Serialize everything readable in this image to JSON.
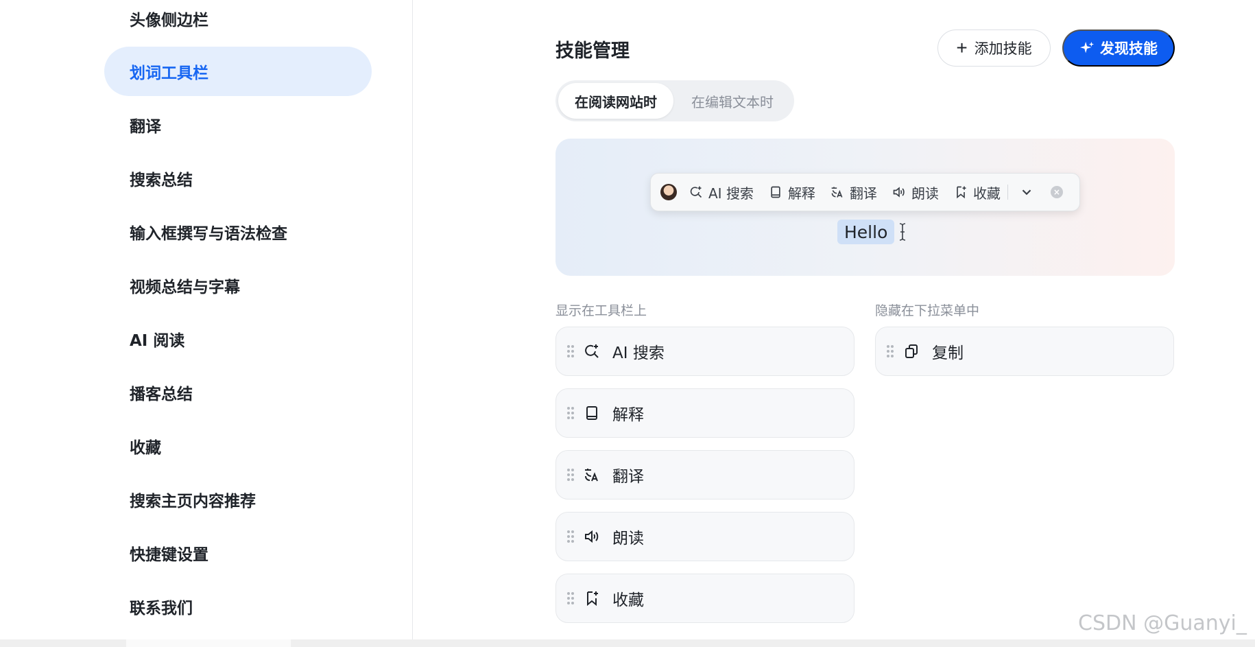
{
  "sidebar": {
    "items": [
      {
        "label": "头像侧边栏",
        "active": false
      },
      {
        "label": "划词工具栏",
        "active": true
      },
      {
        "label": "翻译",
        "active": false
      },
      {
        "label": "搜索总结",
        "active": false
      },
      {
        "label": "输入框撰写与语法检查",
        "active": false
      },
      {
        "label": "视频总结与字幕",
        "active": false
      },
      {
        "label": "AI 阅读",
        "active": false
      },
      {
        "label": "播客总结",
        "active": false
      },
      {
        "label": "收藏",
        "active": false
      },
      {
        "label": "搜索主页内容推荐",
        "active": false
      },
      {
        "label": "快捷键设置",
        "active": false
      },
      {
        "label": "联系我们",
        "active": false
      }
    ]
  },
  "main": {
    "title": "技能管理",
    "add_button": "添加技能",
    "discover_button": "发现技能",
    "tabs": [
      {
        "label": "在阅读网站时",
        "active": true
      },
      {
        "label": "在编辑文本时",
        "active": false
      }
    ],
    "preview": {
      "toolbar_items": [
        {
          "label": "AI 搜索",
          "icon": "search-sparkle-icon"
        },
        {
          "label": "解释",
          "icon": "book-icon"
        },
        {
          "label": "翻译",
          "icon": "translate-icon"
        },
        {
          "label": "朗读",
          "icon": "speaker-icon"
        },
        {
          "label": "收藏",
          "icon": "bookmark-icon"
        }
      ],
      "selected_text": "Hello"
    },
    "shown_label": "显示在工具栏上",
    "hidden_label": "隐藏在下拉菜单中",
    "shown_skills": [
      {
        "label": "AI 搜索",
        "icon": "search-sparkle-icon"
      },
      {
        "label": "解释",
        "icon": "book-icon"
      },
      {
        "label": "翻译",
        "icon": "translate-icon"
      },
      {
        "label": "朗读",
        "icon": "speaker-icon"
      },
      {
        "label": "收藏",
        "icon": "bookmark-icon"
      }
    ],
    "hidden_skills": [
      {
        "label": "复制",
        "icon": "copy-icon"
      }
    ]
  },
  "watermark": "CSDN @Guanyi_",
  "colors": {
    "accent": "#0d5cf0",
    "active_bg": "#e4eefd",
    "active_text": "#1766f2"
  }
}
